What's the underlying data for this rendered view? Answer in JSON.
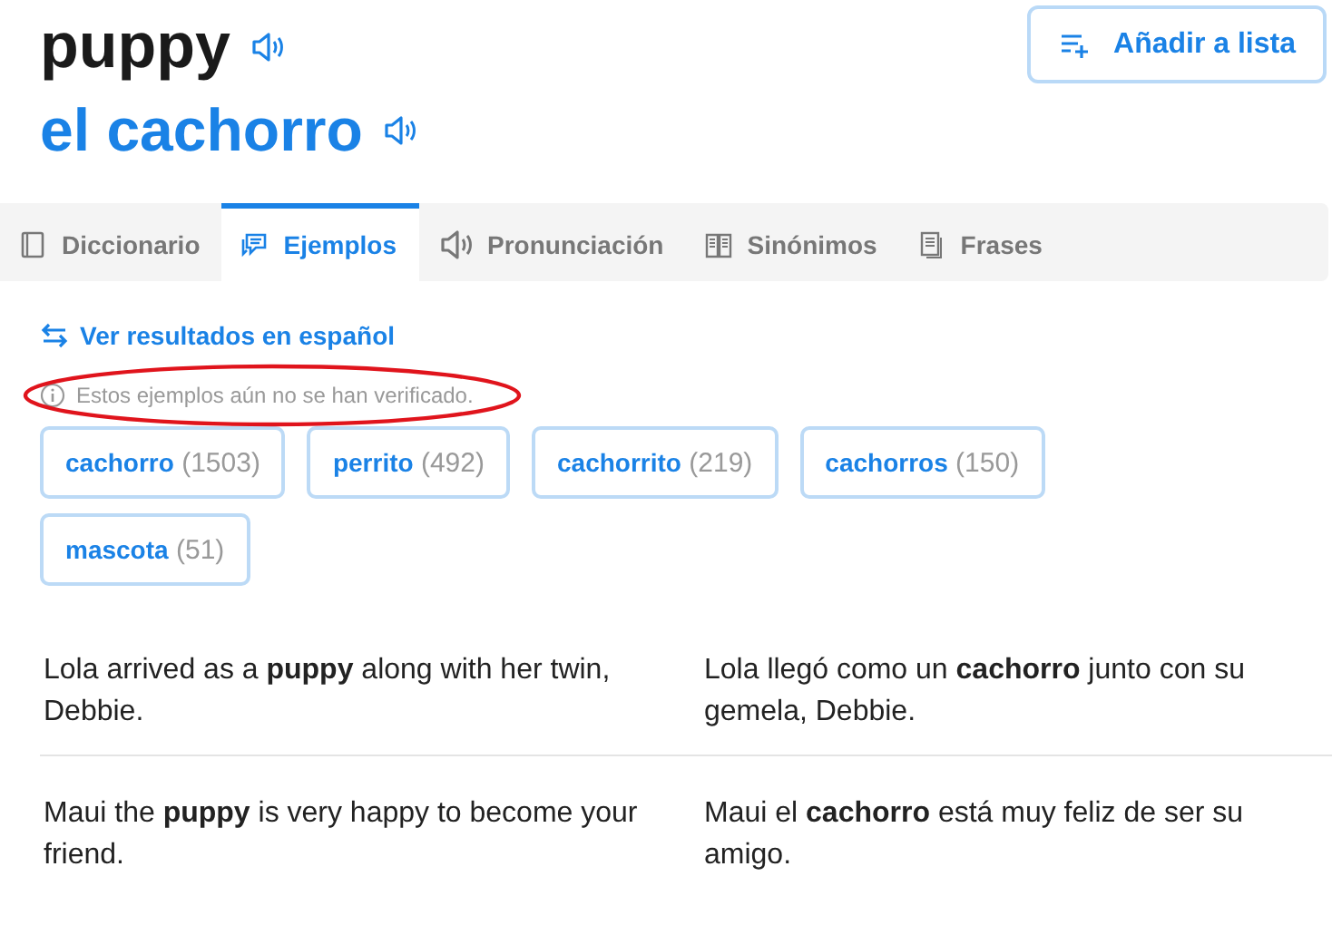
{
  "headword": "puppy",
  "translation": "el cachorro",
  "add_button": "Añadir a lista",
  "tabs": [
    {
      "label": "Diccionario",
      "kind": "dictionary",
      "selected": false
    },
    {
      "label": "Ejemplos",
      "kind": "examples",
      "selected": true
    },
    {
      "label": "Pronunciación",
      "kind": "pronunciation",
      "selected": false
    },
    {
      "label": "Sinónimos",
      "kind": "synonyms",
      "selected": false
    },
    {
      "label": "Frases",
      "kind": "phrases",
      "selected": false
    }
  ],
  "swap_link": "Ver resultados en español",
  "notice": {
    "text": "Estos ejemplos aún no se han verificado.",
    "circled": true
  },
  "filters": [
    {
      "word": "cachorro",
      "count": "(1503)"
    },
    {
      "word": "perrito",
      "count": "(492)"
    },
    {
      "word": "cachorrito",
      "count": "(219)"
    },
    {
      "word": "cachorros",
      "count": "(150)"
    },
    {
      "word": "mascota",
      "count": "(51)"
    }
  ],
  "examples": [
    {
      "source": "Lola arrived as a **puppy** along with her twin, Debbie.",
      "target": "Lola llegó como un **cachorro** junto con su gemela, Debbie."
    },
    {
      "source": "Maui the **puppy** is very happy to become your friend.",
      "target": "Maui el **cachorro** está muy feliz de ser su amigo."
    }
  ]
}
